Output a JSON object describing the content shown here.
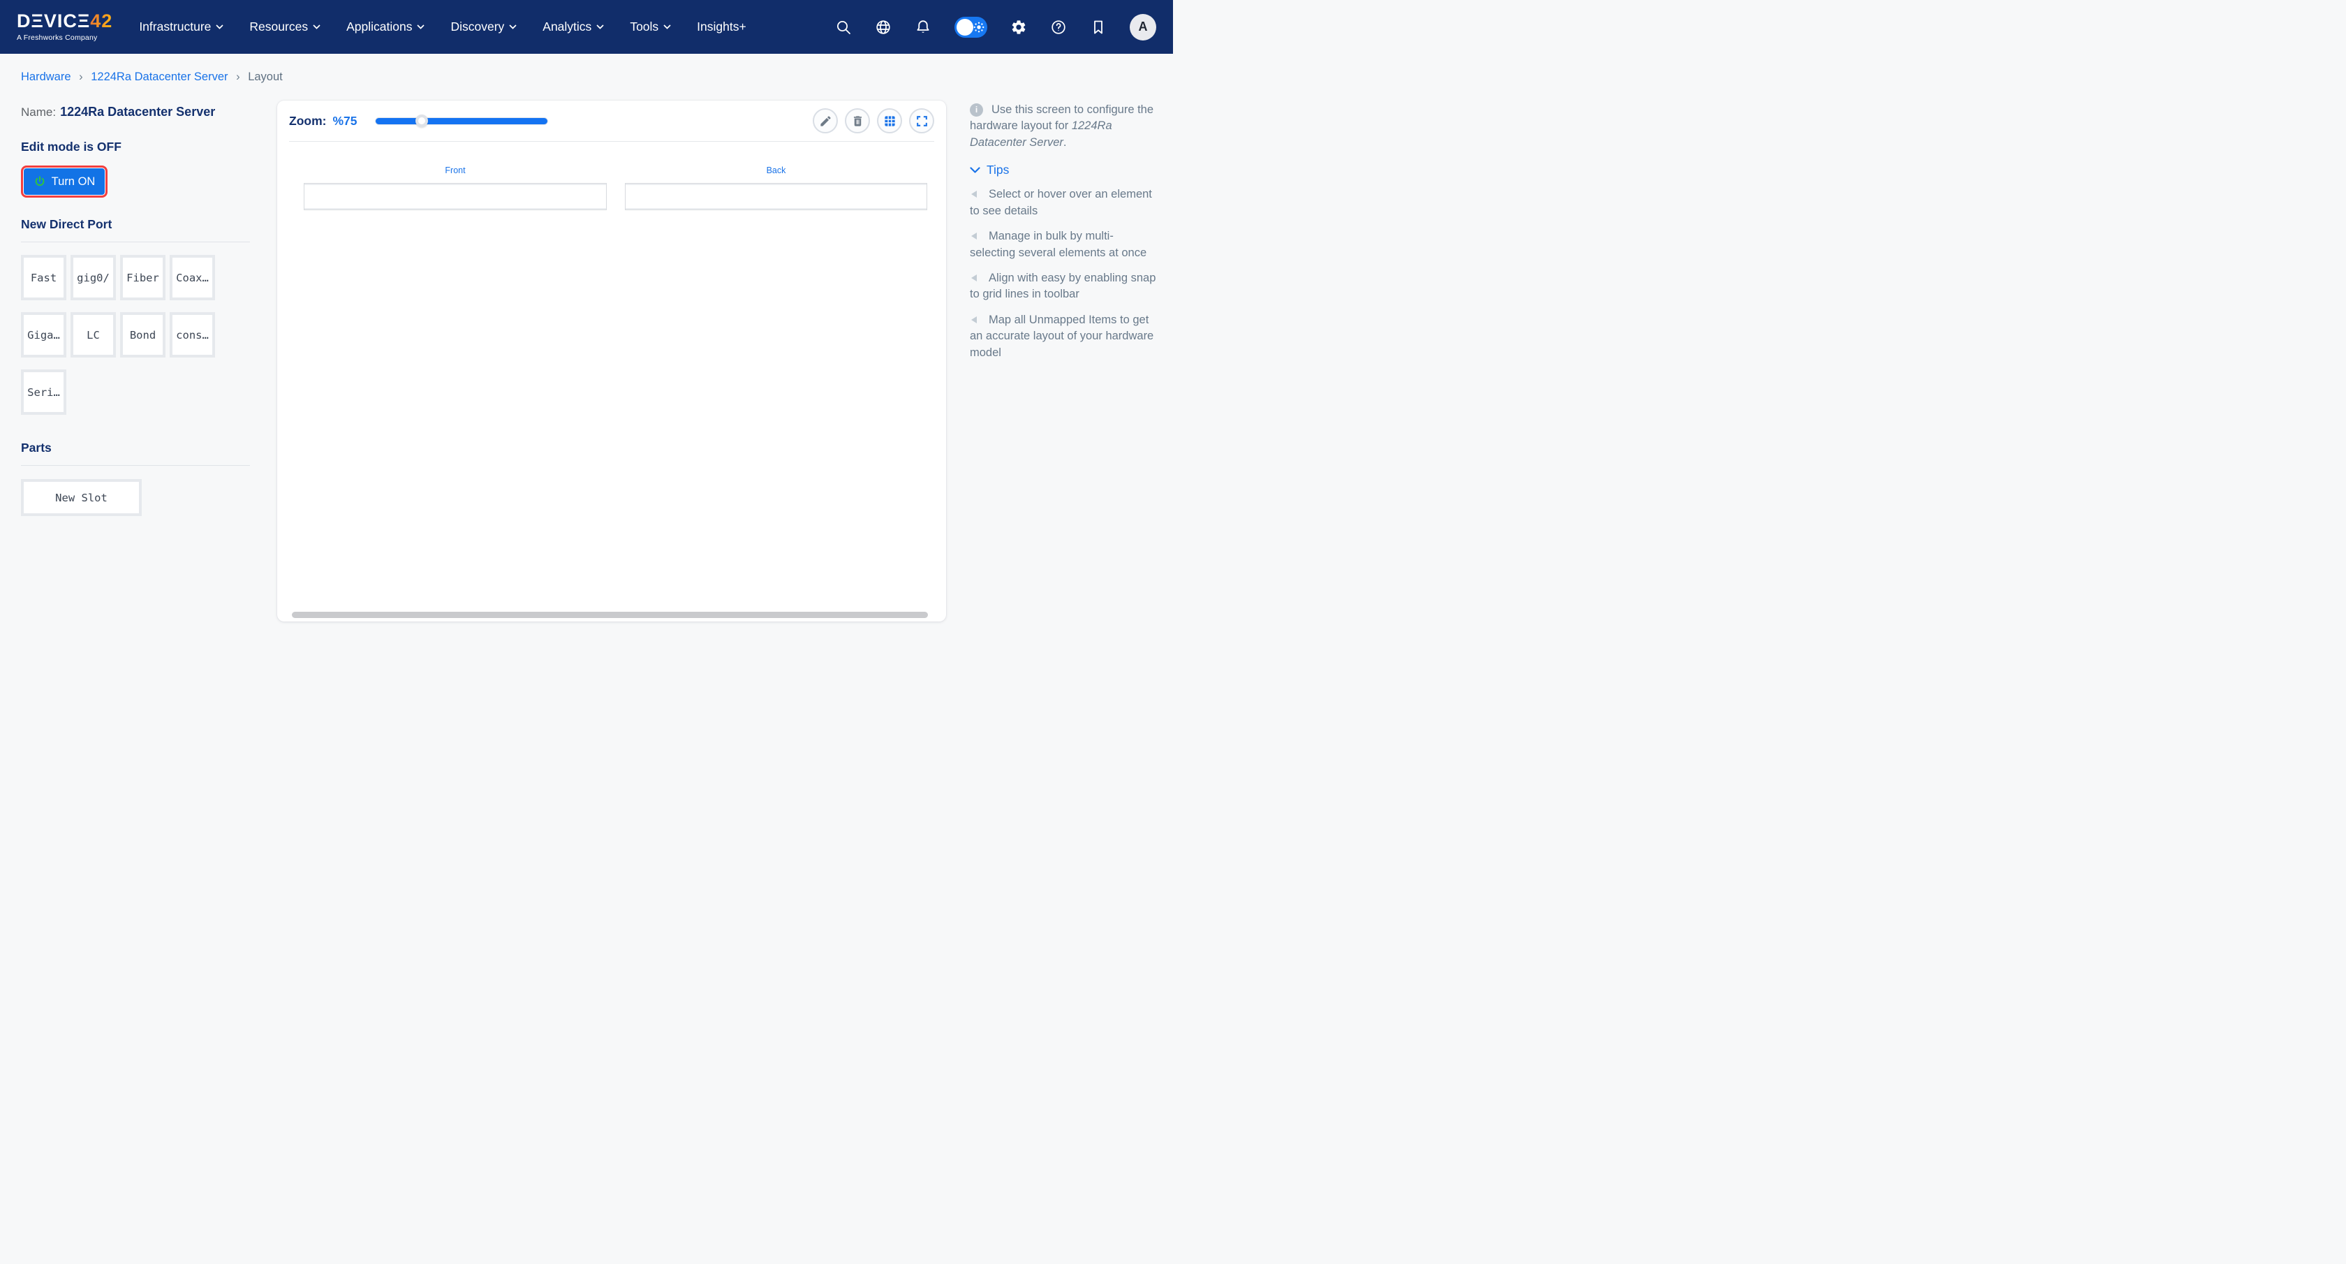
{
  "nav": {
    "logo": {
      "brand_prefix": "DΞVICΞ",
      "brand_suffix": "42",
      "tagline": "A Freshworks Company"
    },
    "items": [
      "Infrastructure",
      "Resources",
      "Applications",
      "Discovery",
      "Analytics",
      "Tools",
      "Insights+"
    ],
    "avatar_letter": "A"
  },
  "breadcrumb": {
    "link1": "Hardware",
    "link2": "1224Ra Datacenter Server",
    "separator": "›",
    "current": "Layout"
  },
  "sidebar": {
    "name_label": "Name:",
    "name_value": "1224Ra Datacenter Server",
    "edit_mode_text": "Edit mode is OFF",
    "turn_on_label": "Turn ON",
    "new_direct_port_heading": "New Direct Port",
    "ports": [
      "Fast",
      "gig0/",
      "Fiber",
      "Coax…",
      "Giga…",
      "LC",
      "Bond",
      "cons…",
      "Seri…"
    ],
    "parts_heading": "Parts",
    "new_slot_label": "New Slot"
  },
  "canvas": {
    "zoom_label": "Zoom:",
    "zoom_value": "%75",
    "zoom_percent": 75,
    "front_label": "Front",
    "back_label": "Back"
  },
  "tips_panel": {
    "intro_prefix": "Use this screen to configure the hardware layout for ",
    "intro_device": "1224Ra Datacenter Server",
    "intro_suffix": ".",
    "tips_heading": "Tips",
    "tips": [
      "Select or hover over an element to see details",
      "Manage in bulk by multi-selecting several elements at once",
      "Align with easy by enabling snap to grid lines in toolbar",
      "Map all Unmapped Items to get an accurate layout of your hardware model"
    ]
  },
  "colors": {
    "nav_navy": "#112d6a",
    "accent_blue": "#1a73e8",
    "slider_blue": "#1473f2",
    "heading_navy": "#14316e",
    "button_blue": "#1273e6",
    "button_outline_red": "#f23f3f",
    "power_green": "#2fc341",
    "logo_orange": "#f6941e",
    "tip_text_gray": "#68798a",
    "page_bg": "#f7f8f9"
  }
}
